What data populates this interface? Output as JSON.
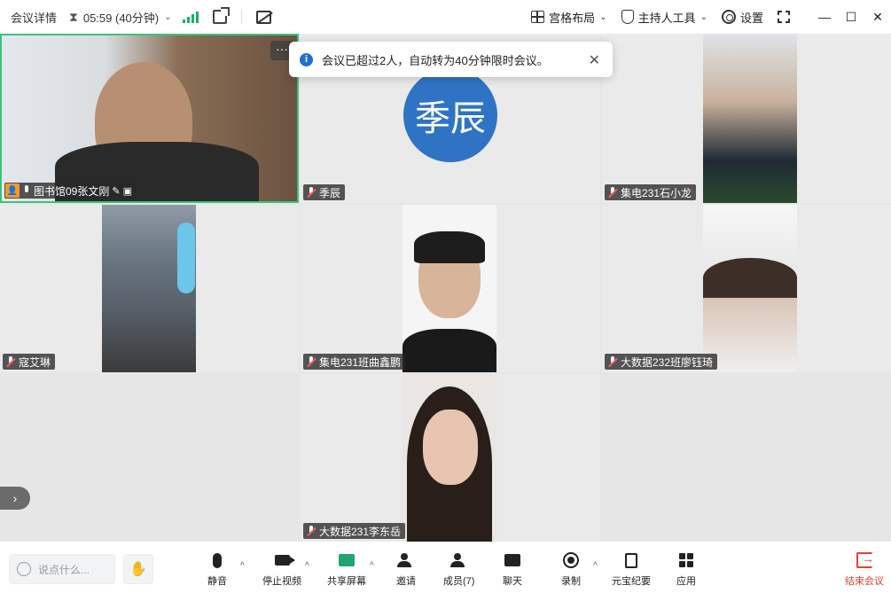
{
  "topbar": {
    "title": "会议详情",
    "timer": "05:59 (40分钟)",
    "layout_label": "宫格布局",
    "host_tools_label": "主持人工具",
    "settings_label": "设置"
  },
  "notification": {
    "text": "会议已超过2人，自动转为40分钟限时会议。"
  },
  "participants": [
    {
      "name": "图书馆09张文刚"
    },
    {
      "name": "季辰",
      "avatar_text": "季辰"
    },
    {
      "name": "集电231石小龙"
    },
    {
      "name": "寇艾琳"
    },
    {
      "name": "集电231班曲鑫鹏"
    },
    {
      "name": "大数据232班廖钰琦"
    },
    {
      "name": "大数据231李东岳"
    }
  ],
  "bottombar": {
    "chat_placeholder": "说点什么...",
    "mute_label": "静音",
    "stop_video_label": "停止视频",
    "share_label": "共享屏幕",
    "invite_label": "邀请",
    "members_label": "成员(7)",
    "chat_label": "聊天",
    "record_label": "录制",
    "yuanbao_label": "元宝纪要",
    "apps_label": "应用",
    "end_label": "结束会议"
  },
  "colors": {
    "accent_green": "#3bc27a",
    "avatar_blue": "#2f73c4",
    "end_red": "#e5432d",
    "host_orange": "#f29a2e"
  }
}
